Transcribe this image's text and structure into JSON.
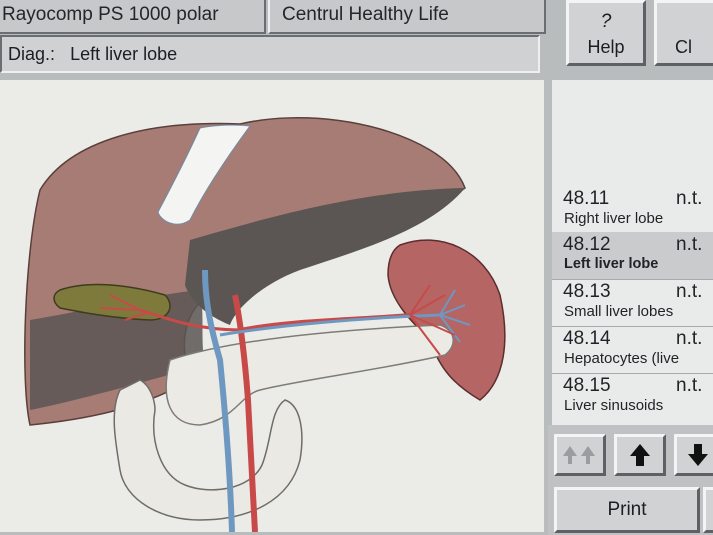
{
  "header": {
    "app_title": "Rayocomp PS 1000 polar",
    "patient_name": "Centrul Healthy Life"
  },
  "diagnosis": {
    "label": "Diag.:",
    "value": "Left liver lobe"
  },
  "toolbar": {
    "help_icon": "?",
    "help_label": "Help",
    "close_label": "Cl"
  },
  "list": {
    "items": [
      {
        "code": "48.11",
        "status": "n.t.",
        "name": "Right liver lobe"
      },
      {
        "code": "48.12",
        "status": "n.t.",
        "name": "Left liver lobe"
      },
      {
        "code": "48.13",
        "status": "n.t.",
        "name": "Small liver lobes"
      },
      {
        "code": "48.14",
        "status": "n.t.",
        "name": "Hepatocytes (live"
      },
      {
        "code": "48.15",
        "status": "n.t.",
        "name": "Liver sinusoids"
      }
    ],
    "selected_index": 1
  },
  "navigation": {
    "first_icon": "double-up-arrow",
    "up_icon": "up-arrow",
    "down_icon": "down-arrow",
    "print_label": "Print"
  },
  "colors": {
    "liver": "#a77c74",
    "liver_dark": "#5b5653",
    "spleen": "#b56563",
    "artery": "#c84a48",
    "vein": "#6e98c0",
    "gallbladder": "#7d7a3c",
    "pancreas": "#eceae5",
    "selection": "#c9cbcc"
  }
}
